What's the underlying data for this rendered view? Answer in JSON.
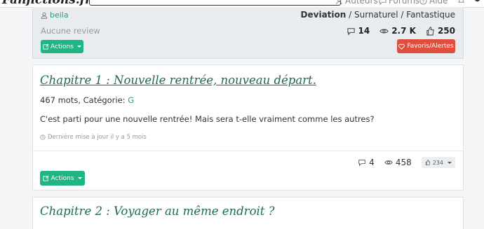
{
  "nav": {
    "logo_text": "Fanfictions.fr",
    "links": [
      {
        "label": "Auteurs",
        "icon": "users-icon"
      },
      {
        "label": "Forums",
        "icon": "chat-icon"
      },
      {
        "label": "Aide",
        "icon": "question-icon"
      }
    ]
  },
  "story": {
    "author": "beila",
    "genre_primary": "Deviation",
    "genre_rest": " / Surnaturel / Fantastique",
    "reviews_text": "Aucune review",
    "stats": {
      "comments": "14",
      "views": "2.7 K",
      "likes": "250"
    },
    "actions_label": "Actions",
    "favorites_label": "Favoris/Alertes"
  },
  "chapters": [
    {
      "title": "Chapitre 1 : Nouvelle rentrée, nouveau départ.",
      "words": "467 mots, Catégorie: ",
      "category": "G",
      "summary": "C'est parti pour une nouvelle rentrée! Mais sera t-elle vraiment comme les autres?",
      "updated": "Dernière mise à jour il y a 5 mois",
      "comments": "4",
      "views": "458",
      "likes": "234",
      "actions_label": "Actions"
    },
    {
      "title": "Chapitre 2 : Voyager au même endroit ?"
    }
  ],
  "colors": {
    "accent": "#20b585",
    "danger": "#e04e3d",
    "title": "#1f6b4f"
  }
}
